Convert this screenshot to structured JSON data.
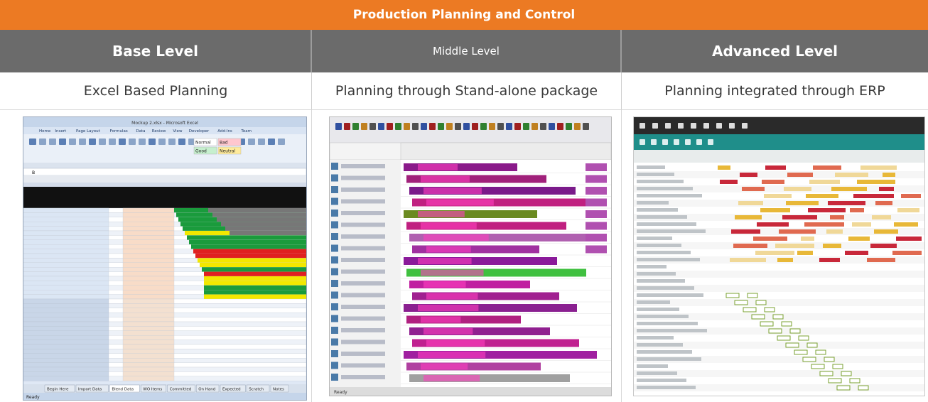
{
  "title": "Production Planning and Control",
  "levels": [
    {
      "name": "Base Level",
      "description": "Excel Based Planning"
    },
    {
      "name": "Middle Level",
      "description": "Planning through Stand-alone package"
    },
    {
      "name": "Advanced Level",
      "description": "Planning integrated through ERP"
    }
  ],
  "excel": {
    "window_title": "Mockup 2.xlsx - Microsoft Excel",
    "ribbon_tabs": [
      "Home",
      "Insert",
      "Page Layout",
      "Formulas",
      "Data",
      "Review",
      "View",
      "Developer",
      "Add-Ins",
      "Team"
    ],
    "styles": [
      "Normal",
      "Bad",
      "Good",
      "Neutral"
    ],
    "name_box": "B",
    "sheet_tabs": [
      "Begin Here",
      "Import Data",
      "Blend Data",
      "WO Items",
      "Committed",
      "On Hand",
      "Expected",
      "Scratch",
      "Notes"
    ],
    "status": "Ready",
    "row_fill_colors": [
      "#1a9b3c",
      "#1a9b3c",
      "#1a9b3c",
      "#1a9b3c",
      "#1a9b3c",
      "#f2e800",
      "#1a9b3c",
      "#1a9b3c",
      "#1a9b3c",
      "#e02020",
      "#e02020",
      "#f2e800",
      "#f2e800",
      "#1a9b3c",
      "#e02020",
      "#f2e800",
      "#f2e800",
      "#1a9b3c",
      "#1a9b3c",
      "#f2e800"
    ]
  },
  "gantt": {
    "row_colors": [
      "#8a1a8a",
      "#a0207a",
      "#7a1a8a",
      "#c02080",
      "#6a8a20",
      "#c02080",
      "#b060b0",
      "#a030a0",
      "#8a1a9a",
      "#40c040",
      "#c020a0",
      "#a02090",
      "#8a2090",
      "#b02080",
      "#902090",
      "#c02090",
      "#a020a0",
      "#b040a0",
      "#a0a0a0"
    ],
    "status": "Ready"
  },
  "erp": {
    "menu_color": "#1f8e8a",
    "bar_colors": [
      "#e8b838",
      "#c8283a",
      "#e06a50",
      "#f0d898"
    ]
  }
}
